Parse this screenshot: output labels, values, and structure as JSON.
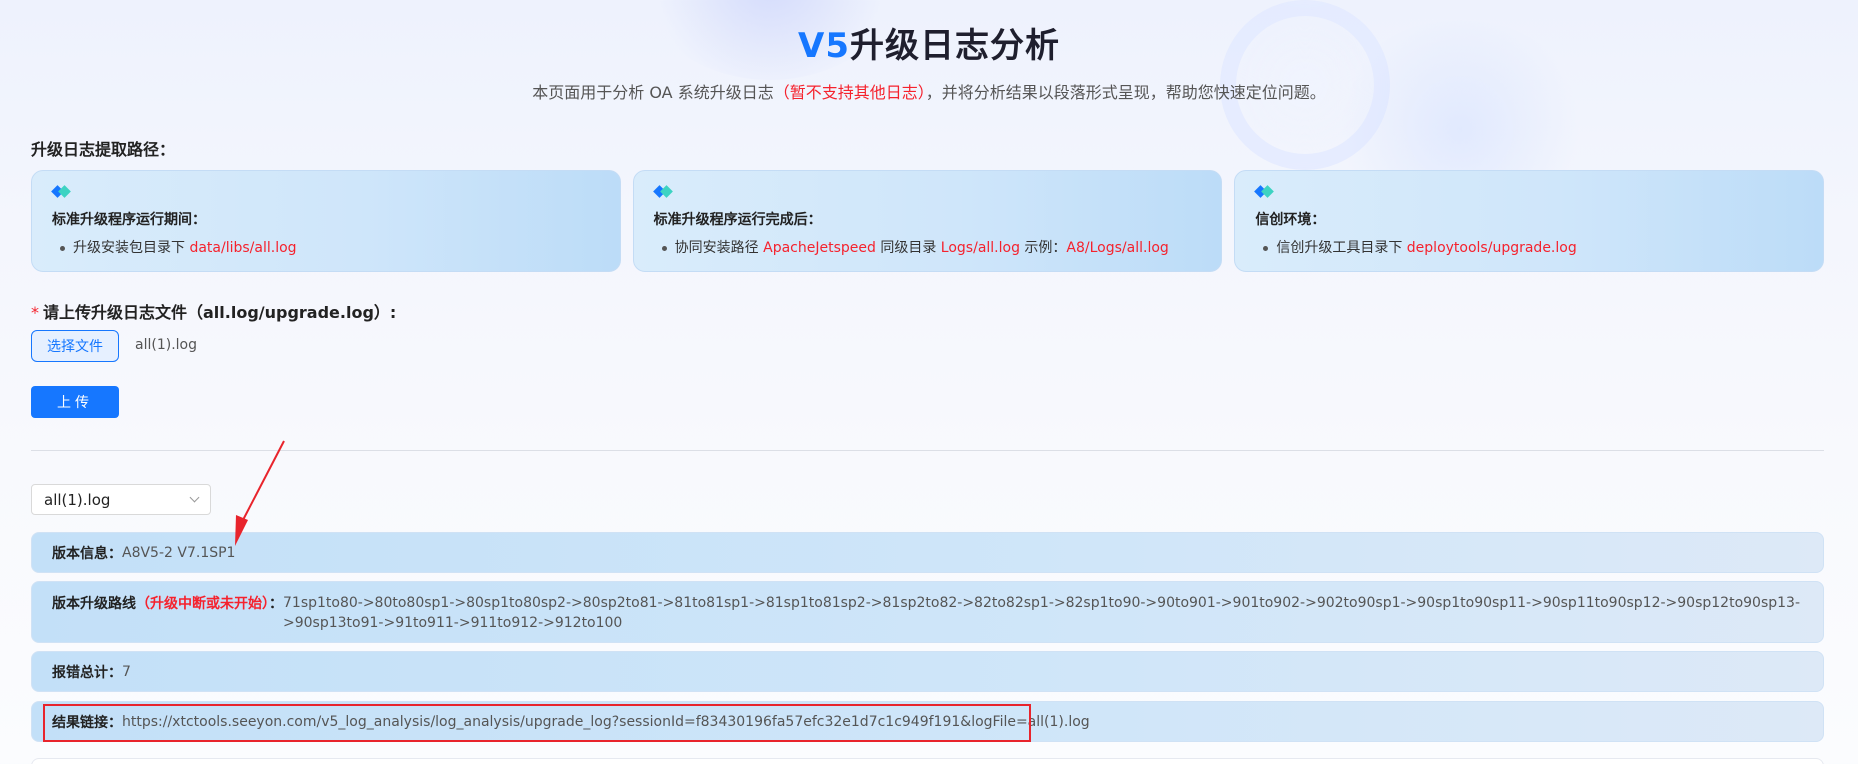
{
  "header": {
    "title_accent": "V5",
    "title_rest": "升级日志分析",
    "subtitle_pre": "本页面用于分析 OA 系统升级日志",
    "subtitle_red": "（暂不支持其他日志）",
    "subtitle_post": "，并将分析结果以段落形式呈现，帮助您快速定位问题。"
  },
  "paths": {
    "label": "升级日志提取路径：",
    "cards": [
      {
        "title": "标准升级程序运行期间：",
        "item_pre": "升级安装包目录下 ",
        "item_red1": "data/libs/all.log"
      },
      {
        "title": "标准升级程序运行完成后：",
        "item_pre": "协同安装路径 ",
        "item_red1": "ApacheJetspeed",
        "item_mid": " 同级目录 ",
        "item_red2": "Logs/all.log",
        "item_mid2": " 示例：",
        "item_red3": "A8/Logs/all.log"
      },
      {
        "title": "信创环境：",
        "item_pre": "信创升级工具目录下 ",
        "item_red1": "deploytools/upgrade.log"
      }
    ]
  },
  "upload": {
    "required_mark": "*",
    "label": "请上传升级日志文件（all.log/upgrade.log）:",
    "choose_label": "选择文件",
    "file_name": "all(1).log",
    "upload_label": "上传"
  },
  "select": {
    "value": "all(1).log"
  },
  "results": {
    "version_key": "版本信息：",
    "version_value": "A8V5-2 V7.1SP1",
    "route_key": "版本升级路线",
    "route_red": "（升级中断或未开始）",
    "route_colon": "：",
    "route_value": "71sp1to80->80to80sp1->80sp1to80sp2->80sp2to81->81to81sp1->81sp1to81sp2->81sp2to82->82to82sp1->82sp1to90->90to901->901to902->902to90sp1->90sp1to90sp11->90sp11to90sp12->90sp12to90sp13->90sp13to91->91to911->911to912->912to100",
    "errors_key": "报错总计：",
    "errors_value": "7",
    "link_key": "结果链接：",
    "link_value": "https://xtctools.seeyon.com/v5_log_analysis/log_analysis/upgrade_log?sessionId=f83430196fa57efc32e1d7c1c949f191&logFile=all(1).log"
  },
  "colors": {
    "accent": "#1677ff",
    "highlight": "#f5222d",
    "annotation": "#e8242c"
  }
}
